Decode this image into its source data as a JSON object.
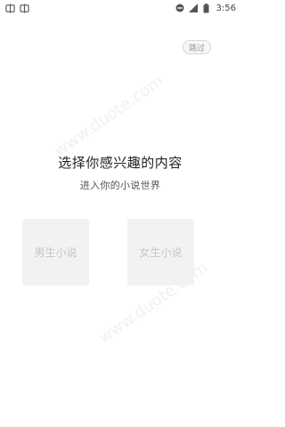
{
  "status_bar": {
    "left_icons": [
      "app-notification-icon",
      "app-notification-icon"
    ],
    "right_icons": [
      "do-not-disturb-icon",
      "cellular-signal-icon",
      "battery-icon"
    ],
    "time": "3:56"
  },
  "skip": {
    "label": "跳过"
  },
  "header": {
    "title": "选择你感兴趣的内容",
    "subtitle": "进入你的小说世界"
  },
  "choices": [
    {
      "label": "男生小说"
    },
    {
      "label": "女生小说"
    }
  ],
  "watermark": {
    "text": "www.duote.com"
  }
}
